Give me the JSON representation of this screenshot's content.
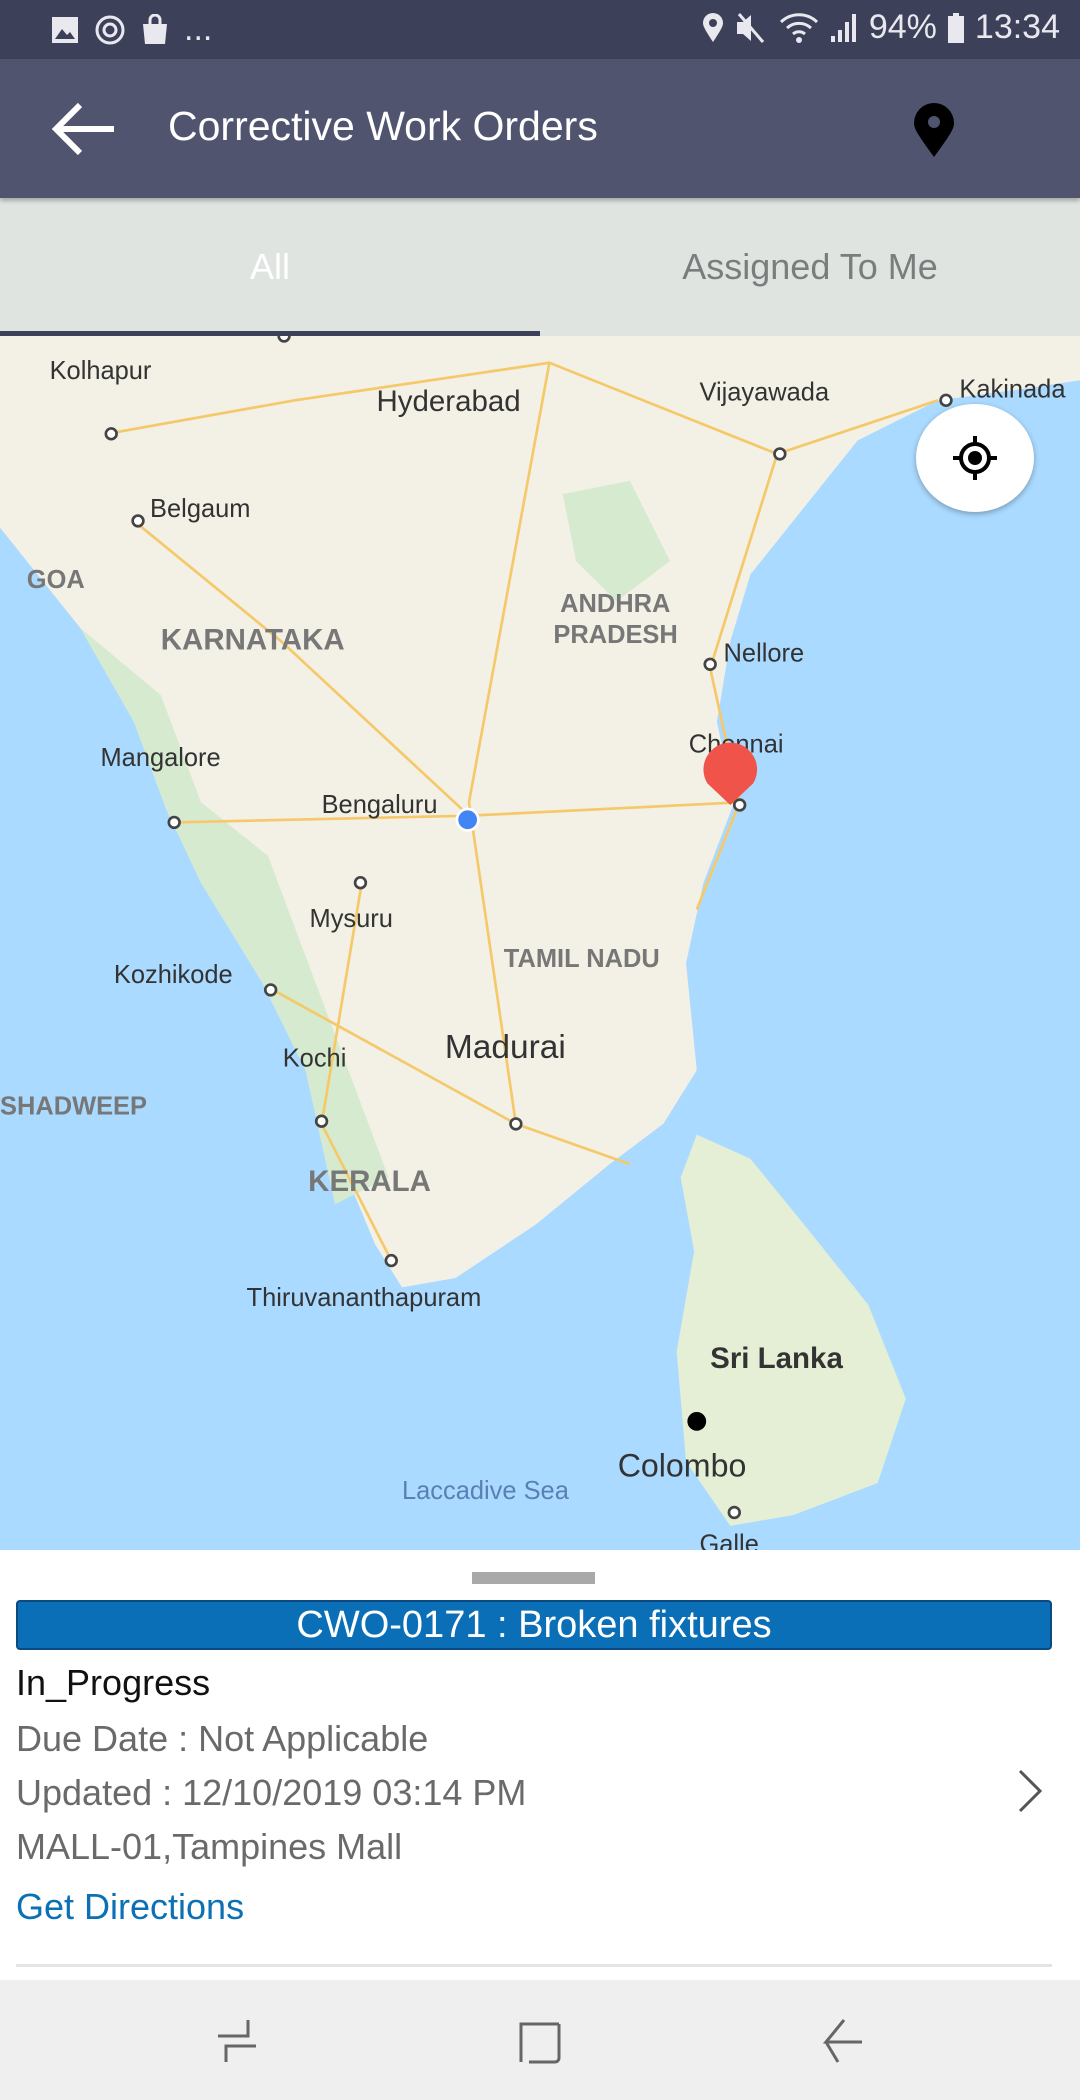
{
  "status_bar": {
    "battery": "94%",
    "time": "13:34",
    "left_icons": [
      "gallery-icon",
      "sync-icon",
      "shopping-bag-icon",
      "more-dots"
    ],
    "more": "...",
    "right_icons": [
      "location-icon",
      "mute-icon",
      "wifi-icon",
      "signal-icon",
      "battery-icon"
    ]
  },
  "app_bar": {
    "title": "Corrective Work Orders",
    "back_icon": "arrow-left-icon",
    "action_icon": "map-pin-icon"
  },
  "tabs": [
    {
      "label": "All",
      "active": true
    },
    {
      "label": "Assigned To Me",
      "active": false
    }
  ],
  "map": {
    "labels": {
      "kolhapur": "Kolhapur",
      "hyderabad": "Hyderabad",
      "vijayawada": "Vijayawada",
      "kakinada": "Kakinada",
      "belgaum": "Belgaum",
      "goa": "GOA",
      "karnataka": "KARNATAKA",
      "andhra1": "ANDHRA",
      "andhra2": "PRADESH",
      "nellore": "Nellore",
      "chennai": "Chennai",
      "mangalore": "Mangalore",
      "bengaluru": "Bengaluru",
      "mysuru": "Mysuru",
      "tamilnadu": "TAMIL NADU",
      "kozhikode": "Kozhikode",
      "madurai": "Madurai",
      "kochi": "Kochi",
      "lakshadweep": "SHADWEEP",
      "kerala": "KERALA",
      "thiruvananthapuram": "Thiruvananthapuram",
      "srilanka": "Sri Lanka",
      "colombo": "Colombo",
      "laccadive": "Laccadive Sea",
      "galle": "Galle"
    },
    "colors": {
      "sea": "#aadaff",
      "land": "#f3f0e6",
      "marker": "#f0534a",
      "user_dot": "#4285f4"
    },
    "locate_icon": "crosshair-icon"
  },
  "work_order": {
    "title": "CWO-0171 : Broken fixtures",
    "status": "In_Progress",
    "due_date": "Due Date : Not Applicable",
    "updated": "Updated : 12/10/2019 03:14 PM",
    "location": "MALL-01,Tampines Mall",
    "directions": "Get Directions",
    "title_color": "#0b6fb8"
  },
  "nav_bar": {
    "icons": [
      "recents-icon",
      "home-icon",
      "back-icon"
    ]
  }
}
